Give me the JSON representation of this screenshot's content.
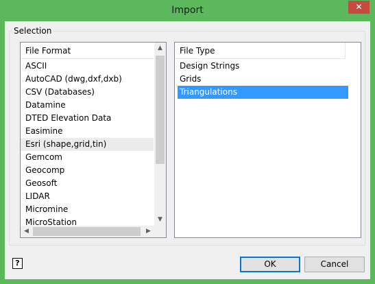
{
  "window": {
    "title": "Import",
    "close_symbol": "✕"
  },
  "selection": {
    "label": "Selection"
  },
  "file_format": {
    "header": "File Format",
    "items": [
      "ASCII",
      "AutoCAD (dwg,dxf,dxb)",
      "CSV (Databases)",
      "Datamine",
      "DTED Elevation Data",
      "Easimine",
      "Esri (shape,grid,tin)",
      "Gemcom",
      "Geocomp",
      "Geosoft",
      "LIDAR",
      "Micromine",
      "MicroStation"
    ],
    "highlighted": "Esri (shape,grid,tin)"
  },
  "file_type": {
    "header": "File Type",
    "items": [
      "Design Strings",
      "Grids",
      "Triangulations"
    ],
    "selected": "Triangulations"
  },
  "buttons": {
    "ok": "OK",
    "cancel": "Cancel"
  },
  "help": {
    "symbol": "?"
  },
  "colors": {
    "titlebar": "#5cb85c",
    "close": "#c74a40",
    "selection": "#3399ff"
  }
}
